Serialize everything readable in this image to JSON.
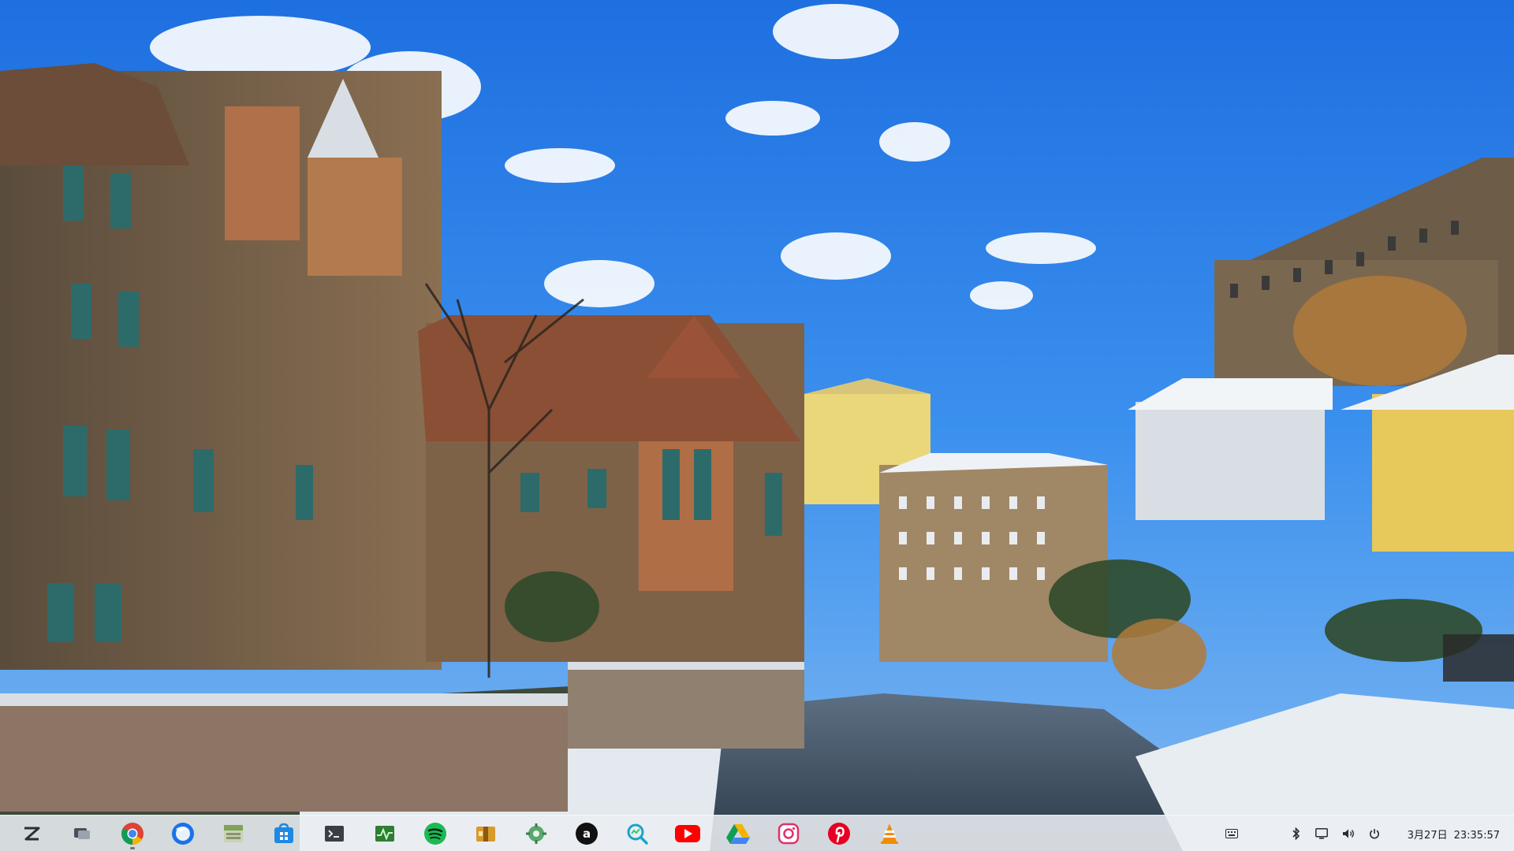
{
  "desktop": {
    "wallpaper": "winter-village-riverside-wallpaper"
  },
  "taskbar": {
    "apps": [
      {
        "name": "launcher-icon",
        "color": "#2b2f36"
      },
      {
        "name": "files-overview-icon",
        "color": "#4a4f58"
      },
      {
        "name": "chrome-icon",
        "color": "#4285f4"
      },
      {
        "name": "firefox-icon",
        "color": "#1a73e8"
      },
      {
        "name": "file-manager-icon",
        "color": "#7da25a"
      },
      {
        "name": "app-store-icon",
        "color": "#1e88e5"
      },
      {
        "name": "terminal-icon",
        "color": "#3a3f47"
      },
      {
        "name": "system-monitor-icon",
        "color": "#2e7d32"
      },
      {
        "name": "spotify-icon",
        "color": "#1db954"
      },
      {
        "name": "archive-icon",
        "color": "#d89a2b"
      },
      {
        "name": "settings-icon",
        "color": "#5aa86b"
      },
      {
        "name": "amazon-icon",
        "color": "#111111"
      },
      {
        "name": "stats-icon",
        "color": "#1aa3c8"
      },
      {
        "name": "youtube-icon",
        "color": "#ff0000"
      },
      {
        "name": "google-drive-icon",
        "color": "#0f9d58"
      },
      {
        "name": "instagram-icon",
        "color": "#e1306c"
      },
      {
        "name": "pinterest-icon",
        "color": "#e60023"
      },
      {
        "name": "vlc-icon",
        "color": "#f28c00"
      }
    ],
    "tray": {
      "keyboard_icon": "keyboard-icon",
      "bluetooth_icon": "bluetooth-icon",
      "screen_icon": "screen-icon",
      "volume_icon": "volume-icon",
      "power_icon": "power-icon"
    },
    "clock": {
      "date": "3月27日",
      "time": "23:35:57"
    }
  }
}
